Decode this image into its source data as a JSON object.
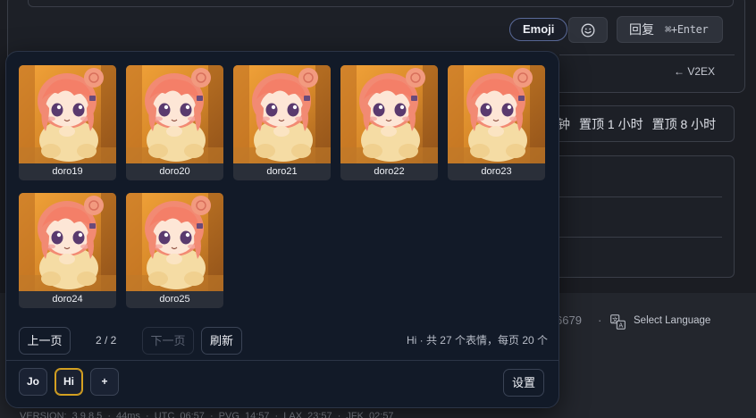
{
  "reply_area": {
    "emoji_label": "Emoji",
    "smile_icon": "smile-icon",
    "reply_label": "回复",
    "reply_shortcut": "⌘+Enter",
    "back_link": "← V2EX"
  },
  "pin_options": [
    "钟",
    "置顶 1 小时",
    "置顶 8 小时"
  ],
  "footer": {
    "partial_number": "6679",
    "separator": "·",
    "translate_icon": "translate-icon",
    "language_link": "Select Language",
    "version_line": "VERSION: 3.9.8.5 · 44ms · UTC 06:57 · PVG 14:57 · LAX 23:57 · JFK 02:57"
  },
  "emoji_picker": {
    "stickers": [
      {
        "name": "doro19"
      },
      {
        "name": "doro20"
      },
      {
        "name": "doro21"
      },
      {
        "name": "doro22"
      },
      {
        "name": "doro23"
      },
      {
        "name": "doro24"
      },
      {
        "name": "doro25"
      }
    ],
    "pager": {
      "prev_label": "上一页",
      "page_indicator": "2 / 2",
      "next_label": "下一页",
      "refresh_label": "刷新",
      "summary": "Hi · 共 27 个表情，每页 20 个"
    },
    "groups": [
      {
        "label": "Jo",
        "active": false
      },
      {
        "label": "Hi",
        "active": true
      },
      {
        "label": "+",
        "active": false
      }
    ],
    "settings_label": "设置"
  },
  "colors": {
    "popup_bg": "#121a28",
    "active_group_border": "#d4a021",
    "page_bg": "#1b1d23"
  }
}
